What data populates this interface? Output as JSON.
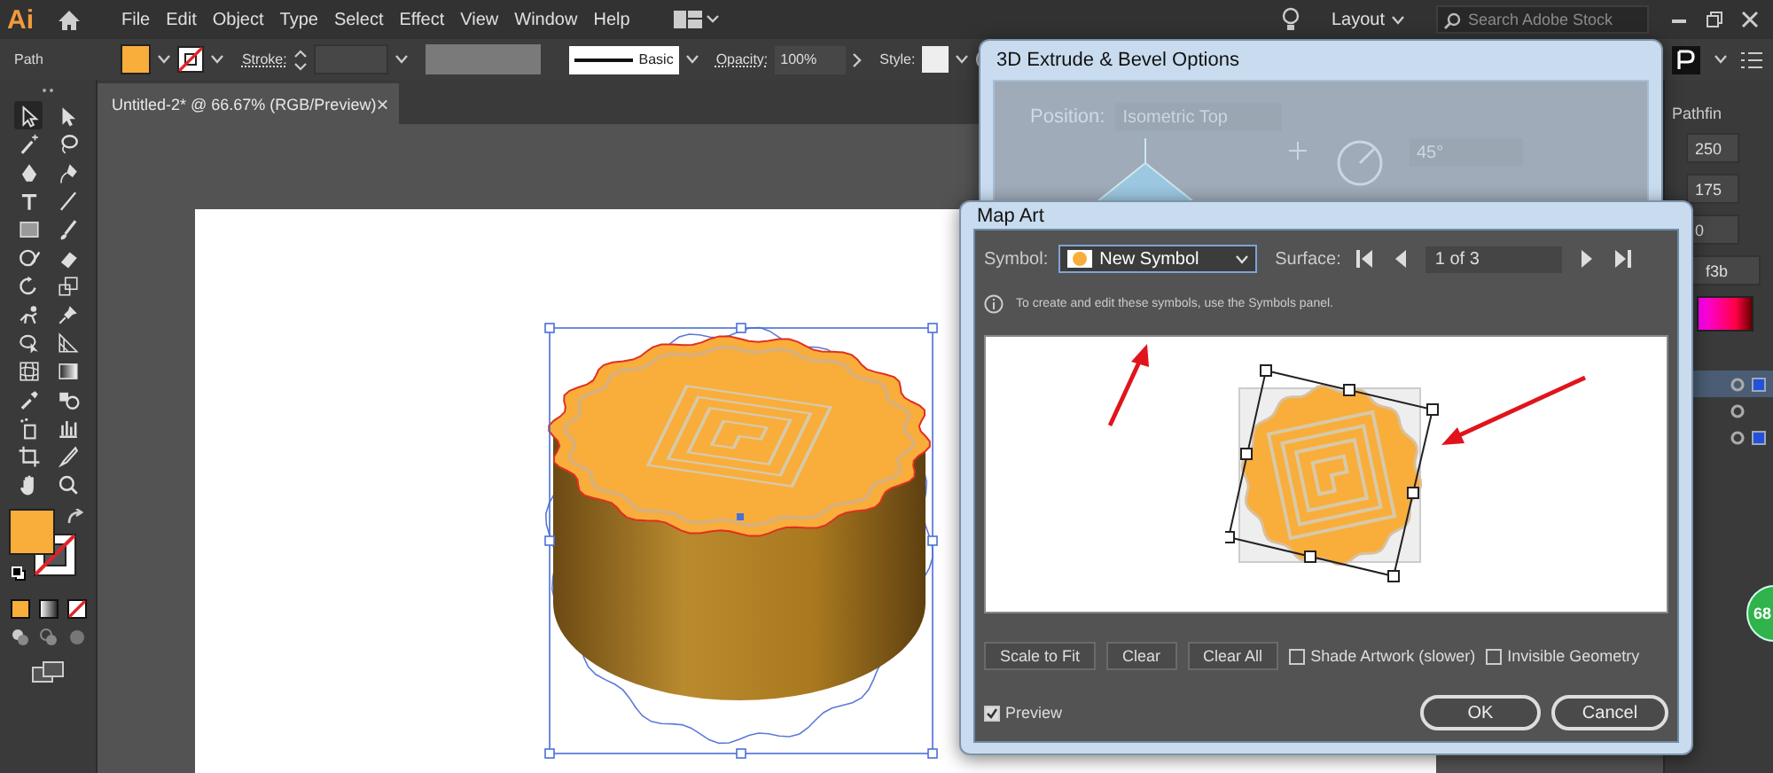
{
  "app_bar": {
    "logo": "Ai",
    "menu": [
      "File",
      "Edit",
      "Object",
      "Type",
      "Select",
      "Effect",
      "View",
      "Window",
      "Help"
    ],
    "layout_label": "Layout",
    "search": {
      "placeholder": "Search Adobe Stock"
    }
  },
  "control_bar": {
    "selection_label": "Path",
    "stroke_label": "Stroke:",
    "brush_label": "Basic",
    "opacity_label": "Opacity:",
    "opacity_value": "100%",
    "style_label": "Style:"
  },
  "document_tab": {
    "title": "Untitled-2* @ 66.67% (RGB/Preview)",
    "close": "×"
  },
  "extrude_dialog": {
    "title": "3D Extrude & Bevel Options",
    "position_label": "Position:",
    "position_value": "Isometric Top",
    "angle_value": "45°"
  },
  "map_art_dialog": {
    "title": "Map Art",
    "symbol_label": "Symbol:",
    "symbol_value": "New Symbol",
    "surface_label": "Surface:",
    "surface_value": "1 of 3",
    "info": "To create and edit these symbols, use the Symbols panel.",
    "buttons": [
      {
        "label": "Scale to Fit"
      },
      {
        "label": "Clear"
      },
      {
        "label": "Clear All"
      }
    ],
    "checkboxes": [
      {
        "label": "Shade Artwork (slower)",
        "checked": false
      },
      {
        "label": "Invisible Geometry",
        "checked": false
      }
    ],
    "preview": {
      "label": "Preview",
      "checked": true
    },
    "ok": "OK",
    "cancel": "Cancel"
  },
  "right_panel": {
    "tab": "Pathfin",
    "fields": [
      "250",
      "175",
      "0",
      "f3b"
    ],
    "layers": [
      {
        "selected": true,
        "selected_art": true
      },
      {
        "selected": false,
        "selected_art": false
      },
      {
        "selected": false,
        "selected_art": true
      }
    ]
  },
  "badge": "68"
}
